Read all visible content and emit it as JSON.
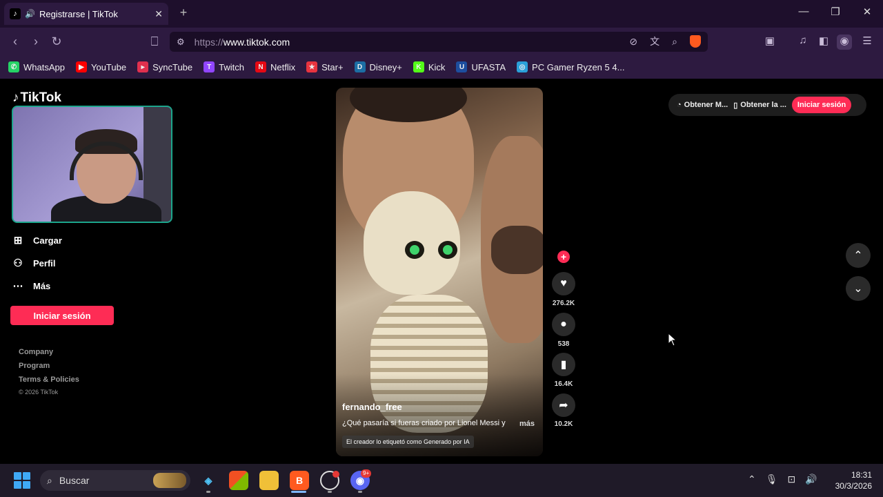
{
  "browser": {
    "tab_title": "Registrarse | TikTok",
    "tab_close": "✕",
    "new_tab": "+",
    "url_scheme": "https://",
    "url_host": "www.tiktok.com",
    "bookmarks": [
      {
        "label": "WhatsApp",
        "icon": "whatsapp-icon",
        "color": "#25d366",
        "glyph": "✆"
      },
      {
        "label": "YouTube",
        "icon": "youtube-icon",
        "color": "#ff0000",
        "glyph": "▶"
      },
      {
        "label": "SyncTube",
        "icon": "synctube-icon",
        "color": "#e0304e",
        "glyph": "▸"
      },
      {
        "label": "Twitch",
        "icon": "twitch-icon",
        "color": "#9146ff",
        "glyph": "T"
      },
      {
        "label": "Netflix",
        "icon": "netflix-icon",
        "color": "#e50914",
        "glyph": "N"
      },
      {
        "label": "Star+",
        "icon": "star-plus-icon",
        "color": "#e8343f",
        "glyph": "★"
      },
      {
        "label": "Disney+",
        "icon": "disney-plus-icon",
        "color": "#1c6ea4",
        "glyph": "D"
      },
      {
        "label": "Kick",
        "icon": "kick-icon",
        "color": "#53fc18",
        "glyph": "K"
      },
      {
        "label": "UFASTA",
        "icon": "ufasta-icon",
        "color": "#1d4e9e",
        "glyph": "U"
      },
      {
        "label": "PC Gamer Ryzen 5 4...",
        "icon": "pc-gamer-icon",
        "color": "#2aa0d8",
        "glyph": "◎"
      }
    ]
  },
  "tiktok": {
    "logo_text": "TikTok",
    "nav": [
      {
        "label": "Cargar",
        "icon": "upload-icon",
        "glyph": "⊞"
      },
      {
        "label": "Perfil",
        "icon": "profile-icon",
        "glyph": "⚇"
      },
      {
        "label": "Más",
        "icon": "more-icon",
        "glyph": "⋯"
      }
    ],
    "login_side": "Iniciar sesión",
    "footer": [
      "Company",
      "Program",
      "Terms & Policies"
    ],
    "copyright": "© 2026 TikTok",
    "top_pill": {
      "get_app_1": "Obtener M...",
      "get_app_2": "Obtener la ...",
      "login": "Iniciar sesión"
    },
    "video": {
      "author": "fernando_free",
      "caption": "¿Qué pasaría si fueras criado por Lionel Messi y",
      "more": "más",
      "ai_label": "El creador lo etiquetó como Generado por IA"
    },
    "actions": {
      "likes": "276.2K",
      "comments": "538",
      "saves": "16.4K",
      "shares": "10.2K"
    }
  },
  "taskbar": {
    "search_placeholder": "Buscar",
    "time": "18:31",
    "date": "30/3/2026",
    "discord_badge": "9+"
  },
  "colors": {
    "accent": "#fe2c55",
    "browser_bg": "#2d1a40"
  }
}
